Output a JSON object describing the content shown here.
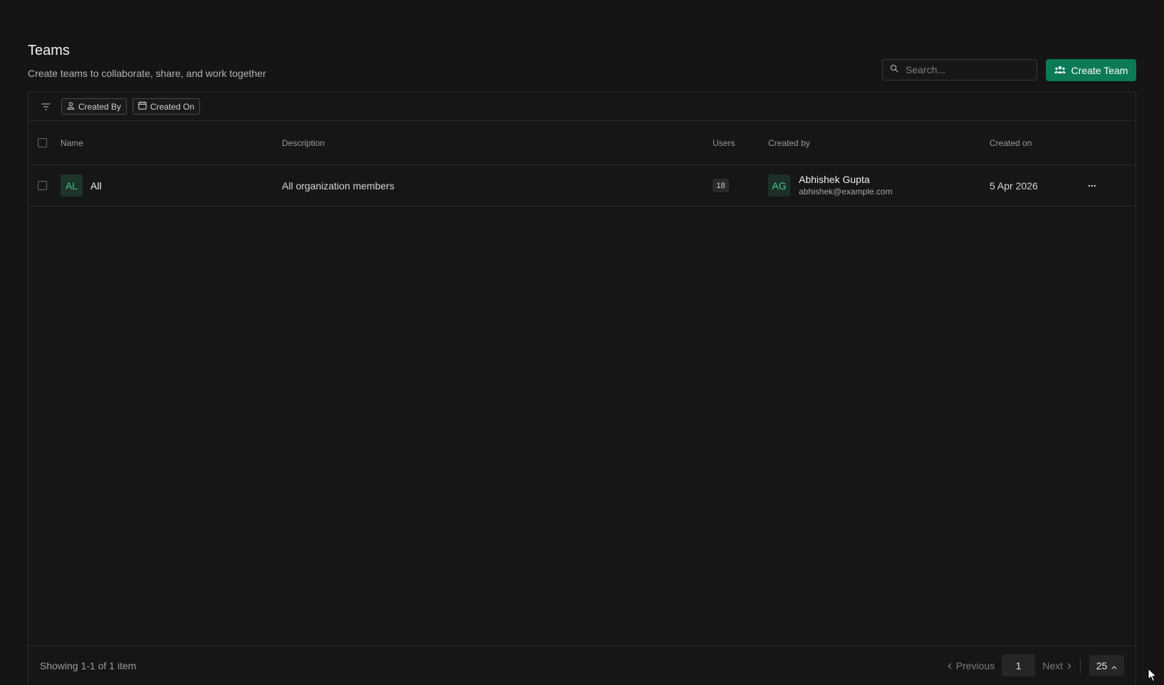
{
  "header": {
    "title": "Teams",
    "subtitle": "Create teams to collaborate, share, and work together"
  },
  "search": {
    "placeholder": "Search...",
    "icon": "search-icon"
  },
  "create_button": {
    "label": "Create Team",
    "icon": "team-icon",
    "color": "#0c7a57"
  },
  "filters": {
    "icon": "filter-icon",
    "chips": [
      {
        "label": "Created By",
        "icon": "user-icon"
      },
      {
        "label": "Created On",
        "icon": "calendar-icon"
      }
    ]
  },
  "table": {
    "columns": [
      "Name",
      "Description",
      "Users",
      "Created by",
      "Created on"
    ],
    "rows": [
      {
        "avatar": "AL",
        "name": "All",
        "description": "All organization members",
        "users": "18",
        "creator_avatar": "AG",
        "creator_name": "Abhishek Gupta",
        "creator_email": "abhishek@example.com",
        "created_on": "5 Apr 2026"
      }
    ]
  },
  "footer": {
    "summary": "Showing 1-1 of 1 item",
    "previous_label": "Previous",
    "next_label": "Next",
    "current_page": "1",
    "page_size": "25"
  },
  "colors": {
    "background": "#151515",
    "accent": "#0c7a57",
    "avatar_text": "#3ec58b"
  }
}
